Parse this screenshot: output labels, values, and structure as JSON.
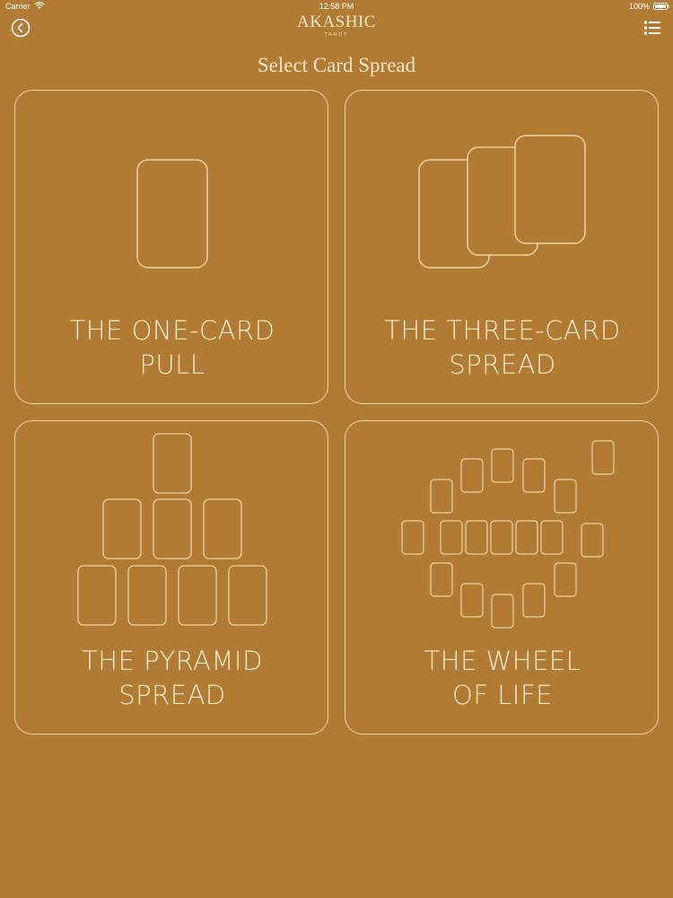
{
  "status_bar": {
    "carrier": "Carrier",
    "time": "12:58 PM",
    "battery": "100%"
  },
  "header": {
    "logo_main": "AKASHIC",
    "logo_sub": "TAROT",
    "back_icon": "back-arrow-circle-icon",
    "menu_icon": "list-menu-icon"
  },
  "page": {
    "title": "Select Card Spread"
  },
  "spreads": [
    {
      "line1": "THE ONE-CARD",
      "line2": "PULL"
    },
    {
      "line1": "THE THREE-CARD",
      "line2": "SPREAD"
    },
    {
      "line1": "THE PYRAMID",
      "line2": "SPREAD"
    },
    {
      "line1": "THE WHEEL",
      "line2": "OF LIFE"
    }
  ],
  "colors": {
    "background": "#b27b33",
    "line": "#e9d3a6",
    "text": "#f6ead0"
  }
}
